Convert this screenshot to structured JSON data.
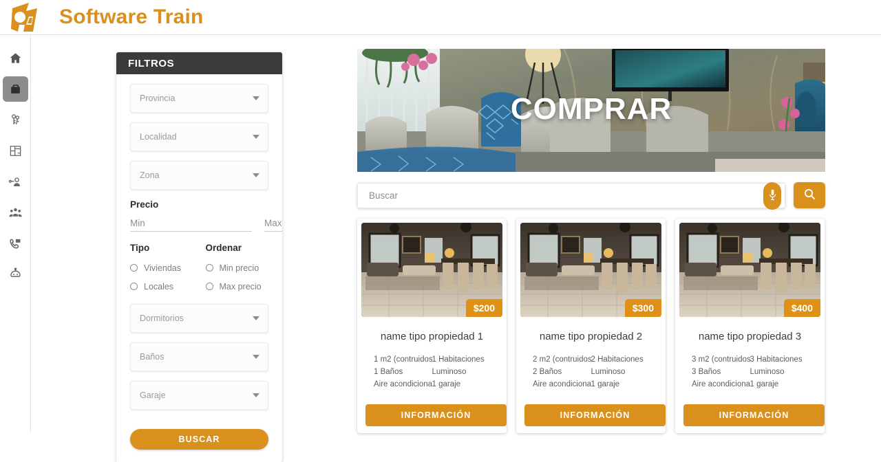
{
  "brand": {
    "name": "Software Train",
    "logo_icon": "camera-6a-logo",
    "color": "#D9901C"
  },
  "sidebar": {
    "items": [
      {
        "icon": "home-icon",
        "name": "home",
        "active": false
      },
      {
        "icon": "briefcase-icon",
        "name": "properties",
        "active": true
      },
      {
        "icon": "keys-icon",
        "name": "rentals",
        "active": false
      },
      {
        "icon": "floorplan-icon",
        "name": "floorplans",
        "active": false
      },
      {
        "icon": "user-key-icon",
        "name": "owners",
        "active": false
      },
      {
        "icon": "people-group-icon",
        "name": "clients",
        "active": false
      },
      {
        "icon": "phone-message-icon",
        "name": "contact",
        "active": false
      },
      {
        "icon": "robot-icon",
        "name": "assistant",
        "active": false
      }
    ]
  },
  "filters": {
    "title": "FILTROS",
    "selects": [
      {
        "name": "provincia",
        "placeholder": "Provincia",
        "value": ""
      },
      {
        "name": "localidad",
        "placeholder": "Localidad",
        "value": ""
      },
      {
        "name": "zona",
        "placeholder": "Zona",
        "value": ""
      }
    ],
    "price": {
      "label": "Precio",
      "min_placeholder": "Min",
      "max_placeholder": "Max",
      "min_value": "",
      "max_value": ""
    },
    "tipo": {
      "label": "Tipo",
      "options": [
        {
          "label": "Viviendas",
          "selected": false
        },
        {
          "label": "Locales",
          "selected": false
        }
      ]
    },
    "ordenar": {
      "label": "Ordenar",
      "options": [
        {
          "label": "Min precio",
          "selected": false
        },
        {
          "label": "Max precio",
          "selected": false
        }
      ]
    },
    "selects2": [
      {
        "name": "dormitorios",
        "placeholder": "Dormitorios",
        "value": ""
      },
      {
        "name": "banos",
        "placeholder": "Baños",
        "value": ""
      },
      {
        "name": "garaje",
        "placeholder": "Garaje",
        "value": ""
      }
    ],
    "submit_label": "BUSCAR"
  },
  "hero": {
    "title": "COMPRAR",
    "image_alt": "modern-living-room"
  },
  "search": {
    "placeholder": "Buscar",
    "value": "",
    "mic_icon": "microphone-icon",
    "search_icon": "search-icon"
  },
  "properties": [
    {
      "title": "name tipo propiedad 1",
      "price": "$200",
      "specs_left": [
        "1 m2 (contruidos",
        "1 Baños",
        "Aire acondiciona"
      ],
      "specs_right": [
        "1 Habitaciones",
        "Luminoso",
        "1 garaje"
      ],
      "button_label": "INFORMACIÓN"
    },
    {
      "title": "name tipo propiedad 2",
      "price": "$300",
      "specs_left": [
        "2 m2 (contruidos",
        "2 Baños",
        "Aire acondiciona"
      ],
      "specs_right": [
        "2 Habitaciones",
        "Luminoso",
        "1 garaje"
      ],
      "button_label": "INFORMACIÓN"
    },
    {
      "title": "name tipo propiedad 3",
      "price": "$400",
      "specs_left": [
        "3 m2 (contruidos",
        "3 Baños",
        "Aire acondiciona"
      ],
      "specs_right": [
        "3 Habitaciones",
        "Luminoso",
        "1 garaje"
      ],
      "button_label": "INFORMACIÓN"
    }
  ]
}
